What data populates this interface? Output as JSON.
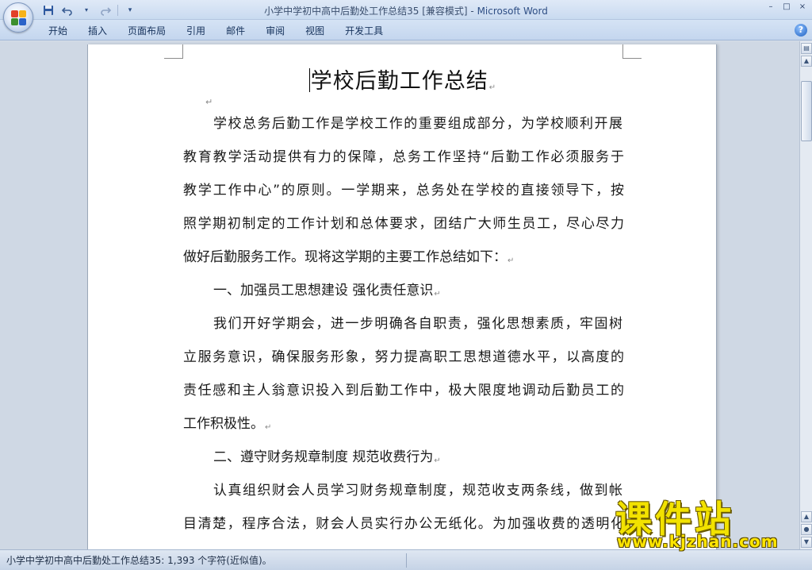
{
  "window": {
    "title": "小学中学初中高中后勤处工作总结35 [兼容模式]",
    "title_sep": " - ",
    "app_name": "Microsoft Word",
    "controls": [
      "–",
      "□",
      "×"
    ]
  },
  "qat": {
    "save_icon": "save-icon",
    "undo_icon": "undo-icon",
    "redo_icon": "redo-icon",
    "customize_icon": "customize-qat-icon"
  },
  "ribbon": {
    "tabs": [
      "开始",
      "插入",
      "页面布局",
      "引用",
      "邮件",
      "审阅",
      "视图",
      "开发工具"
    ],
    "help": "?"
  },
  "document": {
    "title": "学校后勤工作总结",
    "lines": [
      "学校总务后勤工作是学校工作的重要组成部分，为学校顺利开展",
      "教育教学活动提供有力的保障，总务工作坚持“后勤工作必须服务于",
      "教学工作中心”的原则。一学期来，总务处在学校的直接领导下，按",
      "照学期初制定的工作计划和总体要求，团结广大师生员工，尽心尽力",
      "做好后勤服务工作。现将这学期的主要工作总结如下：",
      "一、加强员工思想建设 强化责任意识",
      "我们开好学期会，进一步明确各自职责，强化思想素质，牢固树",
      "立服务意识，确保服务形象，努力提高职工思想道德水平，以高度的",
      "责任感和主人翁意识投入到后勤工作中，极大限度地调动后勤员工的",
      "工作积极性。",
      "二、遵守财务规章制度 规范收费行为",
      "认真组织财会人员学习财务规章制度，规范收支两条线，做到帐",
      "目清楚，程序合法，财会人员实行办公无纸化。为加强收费的透明化"
    ]
  },
  "status": {
    "text": "小学中学初中高中后勤处工作总结35: 1,393 个字符(近似值)。"
  },
  "watermark": {
    "cn": "课件站",
    "url": "www.kjzhan.com"
  },
  "colors": {
    "page": "#ffffff",
    "workspace": "#cfd8e4",
    "ribbon": "#c4d6ee",
    "watermark": "#f2e200"
  }
}
